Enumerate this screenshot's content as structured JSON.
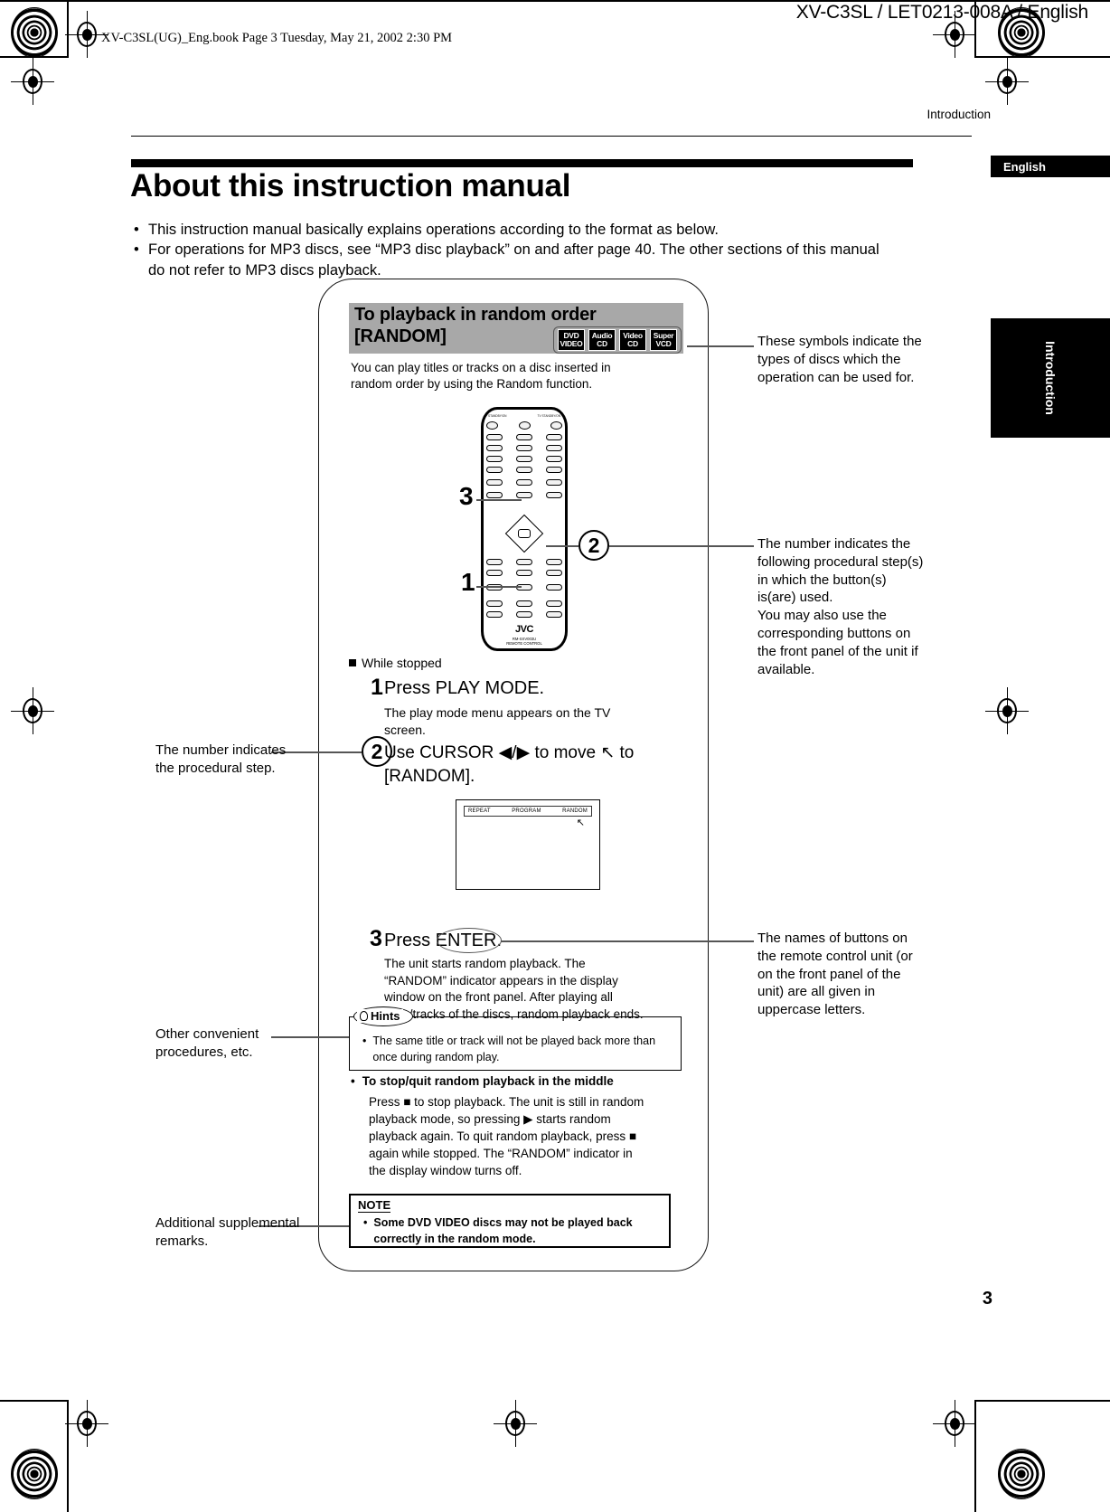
{
  "header": {
    "doc_id": "XV-C3SL / LET0213-008A / English",
    "book_line": "XV-C3SL(UG)_Eng.book  Page 3  Tuesday, May 21, 2002  2:30 PM",
    "section": "Introduction",
    "lang_tab": "English",
    "side_tab": "Introduction",
    "page_number": "3"
  },
  "title": "About this instruction manual",
  "intro_bullets": [
    "This instruction manual basically explains operations according to the format as below.",
    "For operations for MP3 discs, see “MP3 disc playback” on and after page 40. The other sections of this manual do not refer to MP3 discs playback."
  ],
  "sample": {
    "heading_line1": "To playback  in random order",
    "heading_line2": "[RANDOM]",
    "disc_badges": [
      {
        "top": "DVD",
        "bottom": "VIDEO"
      },
      {
        "top": "Audio",
        "bottom": "CD"
      },
      {
        "top": "Video",
        "bottom": "CD"
      },
      {
        "top": "Super",
        "bottom": "VCD"
      }
    ],
    "lead_text": "You can play titles or tracks on a disc inserted in random order by using the Random function.",
    "remote": {
      "brand": "JVC",
      "model_line1": "RM-SXV003U",
      "model_line2": "REMOTE CONTROL"
    },
    "callouts": {
      "three": "3",
      "one": "1",
      "two_remote": "2",
      "two_step": "2"
    },
    "while_stopped": "While stopped",
    "step1": {
      "number": "1",
      "title": "Press PLAY MODE.",
      "detail": "The play mode menu appears on the TV screen."
    },
    "step2": {
      "number": "2",
      "title": "Use CURSOR ◀/▶ to move  ↖  to [RANDOM]."
    },
    "tv_screen": {
      "menu_items": [
        "REPEAT",
        "PROGRAM",
        "RANDOM"
      ],
      "cursor": "↖"
    },
    "step3": {
      "number": "3",
      "title": "Press ENTER.",
      "detail": "The unit starts random playback. The “RANDOM” indicator appears in the display window on the front panel. After playing all titles/tracks of the discs, random playback ends."
    },
    "hints": {
      "label": "Hints",
      "bullet": "•",
      "text": "The same title or track will not be played back more than once during random play."
    },
    "stop_quit": {
      "bullet": "•",
      "title": "To stop/quit random playback in the middle",
      "detail": "Press ■ to stop playback. The unit is still in random playback mode, so pressing ▶ starts random playback again. To quit random playback, press ■ again while stopped.  The “RANDOM” indicator in the display window turns off."
    },
    "note": {
      "label": "NOTE",
      "bullet": "•",
      "text": "Some DVD VIDEO discs may not be played back correctly in the random mode."
    }
  },
  "annotations": {
    "right_symbols": "These symbols indicate the types of discs which the operation can be used for.",
    "right_number": "The number indicates the following procedural step(s) in which the button(s) is(are) used.\nYou may also use the corresponding buttons on the front panel of the unit if available.",
    "right_buttons": "The names of buttons on the remote control unit (or on the front panel of the unit) are all given in uppercase letters.",
    "left_number": "The number indicates the procedural step.",
    "left_other": "Other convenient procedures, etc.",
    "left_additional": "Additional supplemental remarks."
  }
}
